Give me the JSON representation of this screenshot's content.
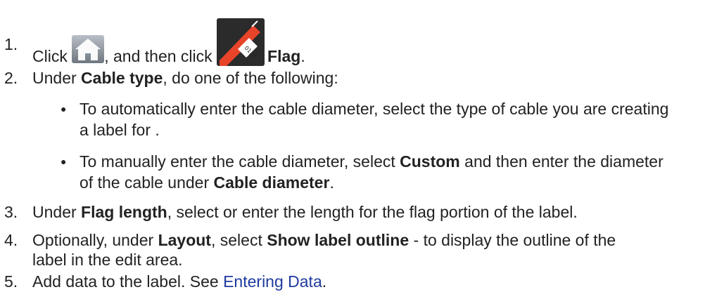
{
  "steps": [
    {
      "number": "1.",
      "prefix": "Click",
      "icon1": "home-icon",
      "middle": ", and then click",
      "icon2": "flag-label-icon",
      "bold": "Flag",
      "suffix": "."
    },
    {
      "number": "2.",
      "prefix": "Under",
      "bold": "Cable type",
      "suffix": ", do one of the following:"
    },
    {
      "number": "3.",
      "prefix": "Under",
      "bold": "Flag length",
      "suffix": ", select or enter the length for the flag portion of the label."
    },
    {
      "number": "4.",
      "prefix": "Optionally, under",
      "bold1": "Layout",
      "mid": ", select",
      "bold2": "Show label outline",
      "suffix_line1": " - to display the outline of the",
      "line2": "label in the edit area."
    },
    {
      "number": "5.",
      "prefix": "Add data to the label. See",
      "link": "Entering Data",
      "suffix": "."
    }
  ],
  "bullets": [
    {
      "marker": "●",
      "line1": "To automatically enter the cable diameter, select the type of cable you are creating",
      "line2": "a label for ."
    },
    {
      "marker": "●",
      "prefix": "To manually enter the cable diameter, select",
      "bold1": "Custom",
      "mid": " and then enter the diameter",
      "line2_prefix": "of the cable under",
      "bold2": "Cable diameter",
      "suffix": "."
    }
  ],
  "icon_label_text": "0123",
  "colors": {
    "text": "#222222",
    "link": "#1f3b9e",
    "flag_red": "#e8442a",
    "flag_dark": "#2b2b2b"
  }
}
